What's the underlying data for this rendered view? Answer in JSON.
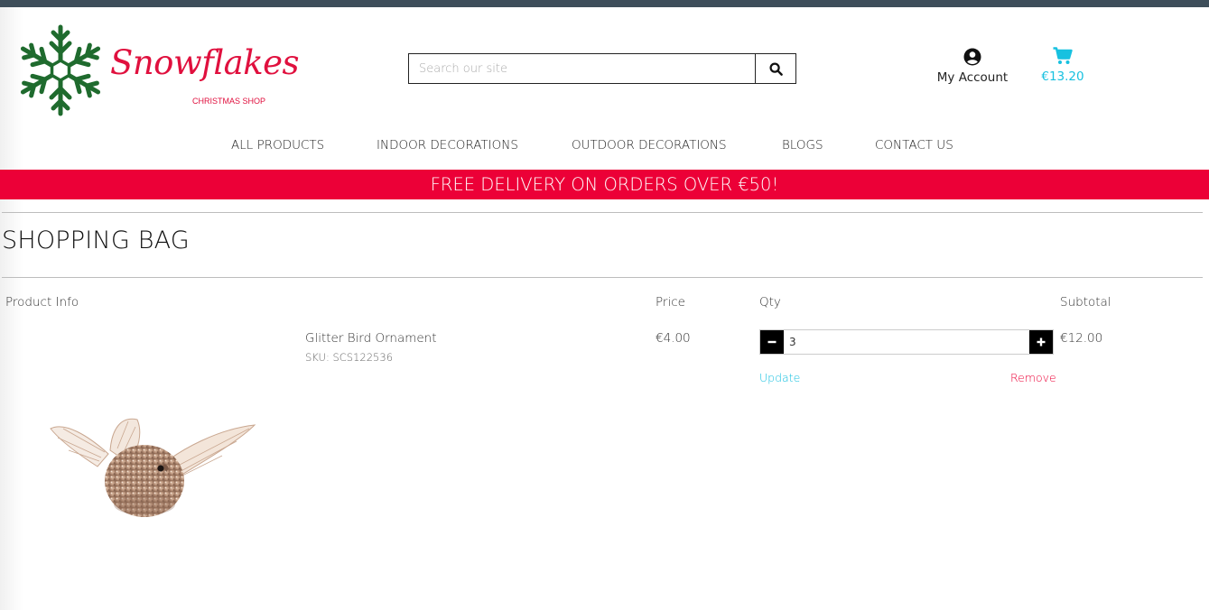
{
  "brand": {
    "name": "Snowflakes",
    "tagline": "CHRISTMAS SHOP",
    "colors": {
      "brand_red": "#e0103e",
      "snowflake_green": "#1f6b2e",
      "accent_cyan": "#17c1e0",
      "topbar": "#3e4e5a"
    }
  },
  "search": {
    "placeholder": "Search our site",
    "value": "",
    "button_icon": "search-icon"
  },
  "account": {
    "label": "My Account",
    "icon": "user-circle-icon"
  },
  "cart": {
    "total": "€13.20",
    "icon": "shopping-cart-icon"
  },
  "nav": {
    "items": [
      {
        "label": "ALL PRODUCTS"
      },
      {
        "label": "INDOOR DECORATIONS"
      },
      {
        "label": "OUTDOOR DECORATIONS"
      },
      {
        "label": "BLOGS"
      },
      {
        "label": "CONTACT US"
      }
    ]
  },
  "banner": {
    "text": "FREE DELIVERY ON ORDERS OVER €50!",
    "color": "#ec0037"
  },
  "page": {
    "title": "SHOPPING BAG"
  },
  "bag": {
    "headers": {
      "product": "Product Info",
      "price": "Price",
      "qty": "Qty",
      "subtotal": "Subtotal"
    },
    "items": [
      {
        "name": "Glitter Bird Ornament",
        "sku": "SKU: SCS122536",
        "price": "€4.00",
        "qty": "3",
        "subtotal": "€12.00",
        "update_label": "Update",
        "remove_label": "Remove",
        "decrement_icon": "minus-icon",
        "increment_icon": "plus-icon",
        "image": "glitter-bird-ornament"
      }
    ]
  }
}
